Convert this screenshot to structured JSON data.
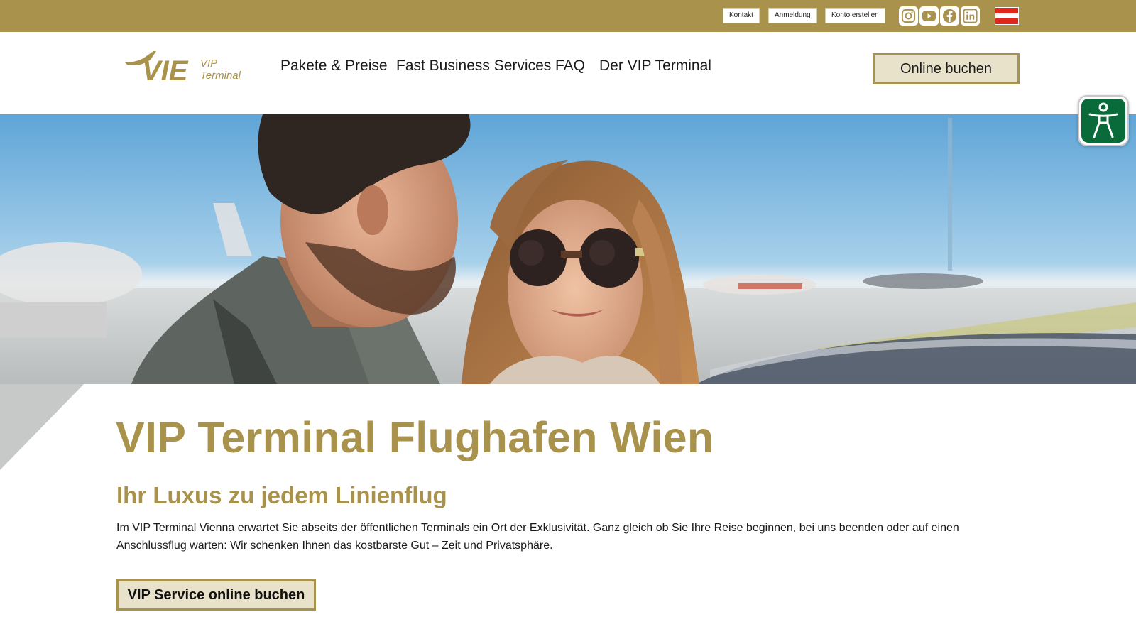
{
  "topbar": {
    "links": [
      "Kontakt",
      "Anmeldung",
      "Konto erstellen"
    ],
    "social": [
      "instagram-icon",
      "youtube-icon",
      "facebook-icon",
      "linkedin-icon"
    ],
    "language_flag": "austria-flag-icon"
  },
  "logo": {
    "mark": "VIE",
    "line1": "VIP",
    "line2": "Terminal"
  },
  "nav": {
    "items": [
      "Pakete & Preise",
      "Fast Business Services",
      "FAQ",
      "Der VIP Terminal"
    ],
    "cta": "Online buchen"
  },
  "hero": {
    "image": "couple-at-airport-photo"
  },
  "content": {
    "title": "VIP Terminal Flughafen Wien",
    "subtitle": "Ihr Luxus zu jedem Linienflug",
    "intro": "Im VIP Terminal Vienna erwartet Sie abseits der öffentlichen Terminals ein Ort der Exklusivität. Ganz gleich ob Sie Ihre Reise beginnen, bei uns beenden oder auf einen Anschlussflug warten: Wir schenken Ihnen das kostbarste Gut – Zeit und Privatsphäre.",
    "cta": "VIP Service online buchen"
  },
  "accessibility": {
    "icon": "accessibility-person-icon"
  },
  "colors": {
    "gold": "#a8924c",
    "button_fill": "#e9e2ca",
    "accessibility_green": "#0a6b3a",
    "flag_red": "#e1261c"
  }
}
